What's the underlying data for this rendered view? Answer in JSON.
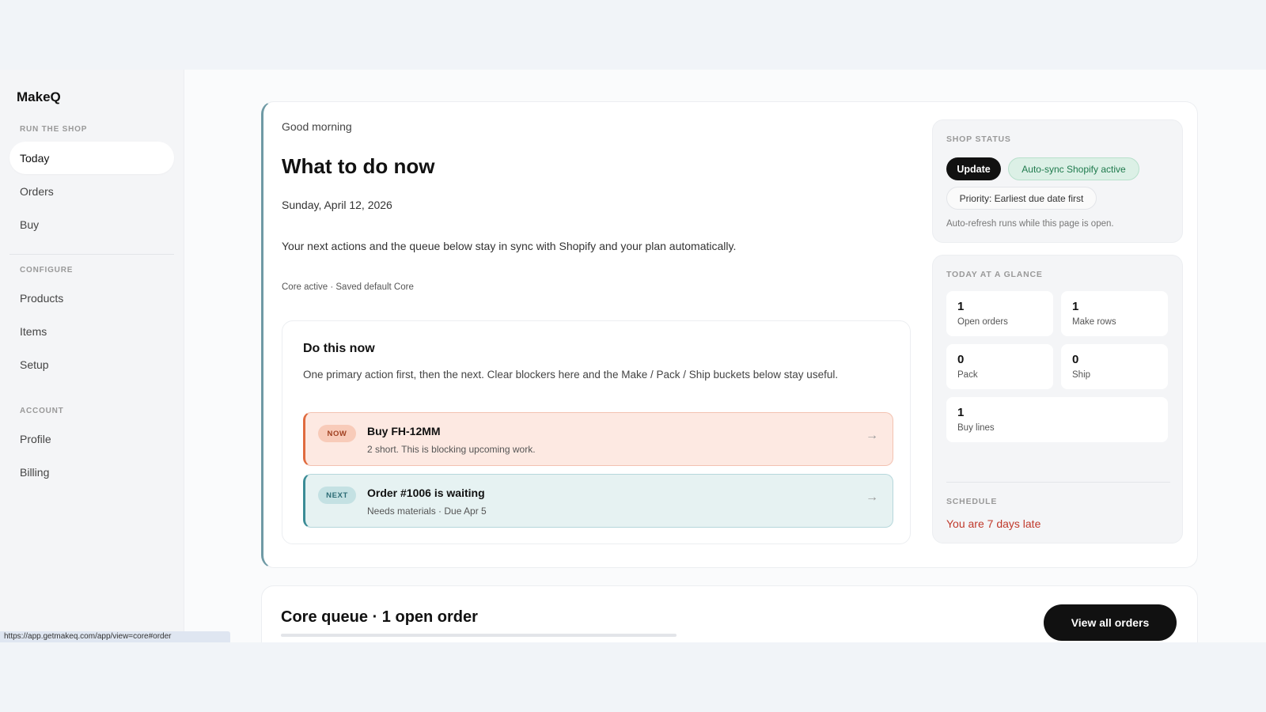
{
  "sidebar": {
    "brand": "MakeQ",
    "sections": [
      {
        "label": "RUN THE SHOP",
        "items": [
          "Today",
          "Orders",
          "Buy"
        ]
      },
      {
        "label": "CONFIGURE",
        "items": [
          "Products",
          "Items",
          "Setup"
        ]
      },
      {
        "label": "ACCOUNT",
        "items": [
          "Profile",
          "Billing"
        ]
      }
    ],
    "active": "Today"
  },
  "status_url": "https://app.getmakeq.com/app/view=core#order",
  "hero": {
    "greeting": "Good morning",
    "title": "What to do now",
    "date": "Sunday, April 12, 2026",
    "description": "Your next actions and the queue below stay in sync with Shopify and your plan automatically.",
    "meta": "Core active · Saved default Core",
    "do_now": {
      "title": "Do this now",
      "description": "One primary action first, then the next. Clear blockers here and the Make / Pack / Ship buckets below stay useful.",
      "actions": [
        {
          "tag": "NOW",
          "title": "Buy FH-12MM",
          "subtitle": "2 short. This is blocking upcoming work.",
          "arrow": "→"
        },
        {
          "tag": "NEXT",
          "title": "Order #1006 is waiting",
          "subtitle": "Needs materials · Due Apr 5",
          "arrow": "→"
        }
      ]
    }
  },
  "shop_status": {
    "label": "SHOP STATUS",
    "update_button": "Update",
    "sync_badge": "Auto-sync Shopify active",
    "priority_badge": "Priority: Earliest due date first",
    "note": "Auto-refresh runs while this page is open."
  },
  "glance": {
    "label": "TODAY AT A GLANCE",
    "stats": [
      {
        "value": "1",
        "label": "Open orders"
      },
      {
        "value": "1",
        "label": "Make rows"
      },
      {
        "value": "0",
        "label": "Pack"
      },
      {
        "value": "0",
        "label": "Ship"
      },
      {
        "value": "1",
        "label": "Buy lines"
      }
    ],
    "schedule_label": "SCHEDULE",
    "schedule_value": "You are 7 days late"
  },
  "queue": {
    "title": "Core queue · 1 open order",
    "button": "View all orders"
  },
  "colors": {
    "now_accent": "#e06b3f",
    "next_accent": "#3b8c96",
    "sync_green": "#1f7a4d",
    "late_red": "#c0392b"
  }
}
